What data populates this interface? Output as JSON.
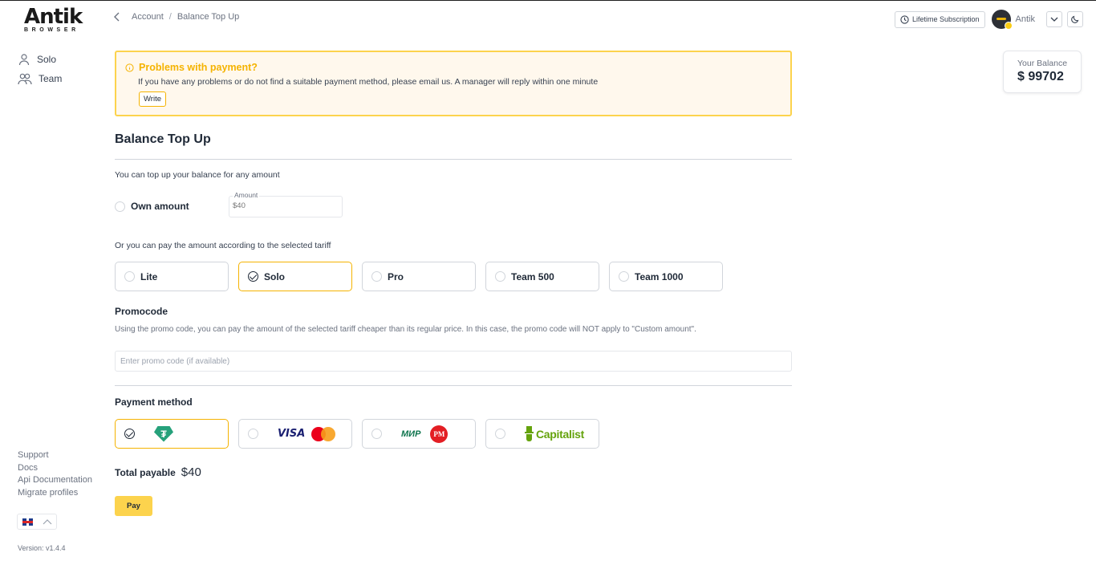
{
  "brand": {
    "name": "Antik",
    "subtitle": "BROWSER"
  },
  "sidebar": {
    "items": [
      {
        "label": "Solo",
        "icon": "user-icon"
      },
      {
        "label": "Team",
        "icon": "users-icon"
      }
    ],
    "footer_links": [
      "Support",
      "Docs",
      "Api Documentation",
      "Migrate profiles"
    ],
    "language": "en-GB",
    "version": "Version: v1.4.4"
  },
  "header": {
    "breadcrumb": [
      "Account",
      "Balance Top Up"
    ],
    "lifetime_label": "Lifetime Subscription",
    "username": "Antik"
  },
  "balance": {
    "label": "Your Balance",
    "value": "$ 99702"
  },
  "alert": {
    "title": "Problems with payment?",
    "message": "If you have any problems or do not find a suitable payment method, please email us. A manager will reply within one minute",
    "button": "Write"
  },
  "page": {
    "title": "Balance Top Up",
    "intro": "You can top up your balance for any amount",
    "own_amount_label": "Own amount",
    "amount_field_label": "Amount",
    "amount_placeholder": "$40",
    "tariff_intro": "Or you can pay the amount according to the selected tariff",
    "tariffs": [
      {
        "label": "Lite",
        "selected": false
      },
      {
        "label": "Solo",
        "selected": true
      },
      {
        "label": "Pro",
        "selected": false
      },
      {
        "label": "Team 500",
        "selected": false
      },
      {
        "label": "Team 1000",
        "selected": false
      }
    ],
    "promocode_title": "Promocode",
    "promocode_note": "Using the promo code, you can pay the amount of the selected tariff cheaper than its regular price. In this case, the promo code will NOT apply to \"Custom amount\".",
    "promocode_placeholder": "Enter promo code (if available)",
    "payment_title": "Payment method",
    "payment_methods": [
      {
        "name": "tether-usdt",
        "selected": true
      },
      {
        "name": "visa-mastercard",
        "visa_text": "VISA",
        "selected": false
      },
      {
        "name": "mir-perfect-money",
        "mir_text": "МИР",
        "pm_text": "PM",
        "selected": false
      },
      {
        "name": "capitalist",
        "text": "Capitalist",
        "selected": false
      }
    ],
    "total_label": "Total payable",
    "total_value": "$40",
    "pay_button": "Pay"
  },
  "colors": {
    "accent": "#f5b301",
    "alert_bg": "#fff8ed",
    "pay_button": "#fcd34d"
  }
}
